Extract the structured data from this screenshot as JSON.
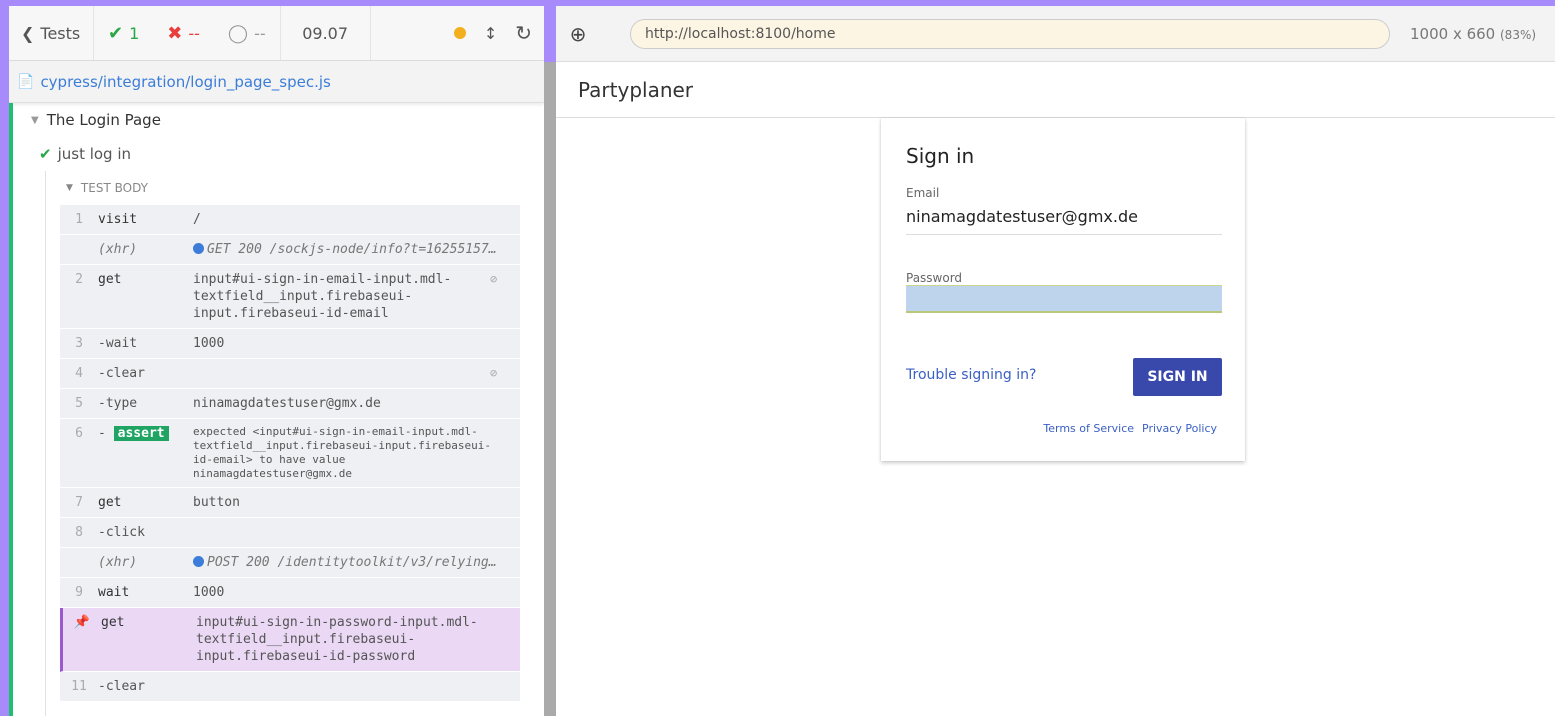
{
  "reporter": {
    "tests_label": "Tests",
    "passed": "1",
    "failed": "--",
    "pending": "--",
    "duration": "09.07",
    "spec_file": "cypress/integration/login_page_spec.js",
    "suite_title": "The Login Page",
    "test_title": "just log in",
    "body_label": "TEST BODY",
    "commands": [
      {
        "num": "1",
        "name": "visit",
        "msg": "/"
      },
      {
        "num": "",
        "name": "(xhr)",
        "msg": "GET 200 /sockjs-node/info?t=16255157…"
      },
      {
        "num": "2",
        "name": "get",
        "msg": "input#ui-sign-in-email-input.mdl-\ntextfield__input.firebaseui-\ninput.firebaseui-id-email"
      },
      {
        "num": "3",
        "name": "-wait",
        "msg": "1000"
      },
      {
        "num": "4",
        "name": "-clear",
        "msg": ""
      },
      {
        "num": "5",
        "name": "-type",
        "msg": "ninamagdatestuser@gmx.de"
      },
      {
        "num": "6",
        "name": "assert",
        "msg": "expected <input#ui-sign-in-email-input.mdl-\ntextfield__input.firebaseui-input.firebaseui-\nid-email> to have value\n ninamagdatestuser@gmx.de"
      },
      {
        "num": "7",
        "name": "get",
        "msg": "button"
      },
      {
        "num": "8",
        "name": "-click",
        "msg": ""
      },
      {
        "num": "",
        "name": "(xhr)",
        "msg": "POST 200 /identitytoolkit/v3/relying…"
      },
      {
        "num": "9",
        "name": "wait",
        "msg": "1000"
      },
      {
        "num": "",
        "name": "get",
        "msg": "input#ui-sign-in-password-input.mdl-\ntextfield__input.firebaseui-\ninput.firebaseui-id-password"
      },
      {
        "num": "11",
        "name": "-clear",
        "msg": ""
      }
    ]
  },
  "runner": {
    "url": "http://localhost:8100/home",
    "viewport": "1000 x 660",
    "scale": "(83%)"
  },
  "app": {
    "title": "Partyplaner",
    "card_title": "Sign in",
    "email_label": "Email",
    "email_value": "ninamagdatestuser@gmx.de",
    "password_label": "Password",
    "trouble_link": "Trouble signing in?",
    "signin_button": "SIGN IN",
    "terms_link": "Terms of Service",
    "privacy_link": "Privacy Policy"
  },
  "colors": {
    "pass": "#28a745",
    "fail": "#e83e3e",
    "accent": "#3949ab",
    "active_row": "#ead8f5"
  }
}
